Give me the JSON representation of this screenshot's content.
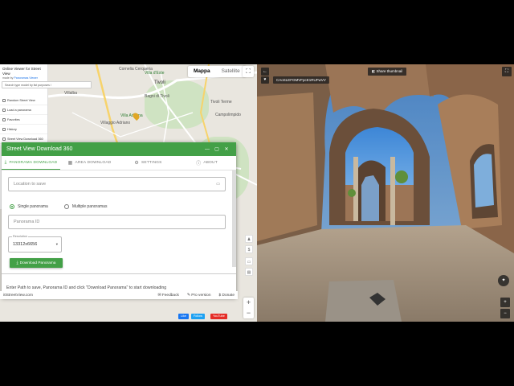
{
  "map": {
    "panel_title": "Online Viewer for Street View",
    "panel_subtitle_prefix": "made by",
    "panel_subtitle_link": "Panoramas Viewer",
    "search_placeholder": "Search type model by list purposes /",
    "panel_items": [
      "Random Street View",
      "Load a panorama",
      "Favorites",
      "History",
      "Street View Download 360"
    ],
    "type_tabs": [
      "Mappa",
      "Satellite"
    ],
    "places": [
      "Tivoli",
      "Villa d'Este",
      "Villa Adriana",
      "Villaggio Adriano",
      "Villalba",
      "Cornelia Cerqueria",
      "Bagni di Tivoli",
      "Tivoli Terme",
      "Campolimpido"
    ],
    "footer_site": "i0StreetView.com",
    "footer_links": [
      "Feedback",
      "Pro version",
      "Donate"
    ],
    "social": [
      "Like",
      "Follow",
      "YouTube"
    ],
    "zoom_in": "+",
    "zoom_out": "−"
  },
  "dialog": {
    "title": "Street View Download 360",
    "tabs": [
      {
        "label": "PANORAMA DOWNLOAD",
        "icon": "download-icon"
      },
      {
        "label": "AREA DOWNLOAD",
        "icon": "map-icon"
      },
      {
        "label": "SETTINGS",
        "icon": "gear-icon"
      },
      {
        "label": "ABOUT",
        "icon": "info-icon"
      }
    ],
    "location_placeholder": "Location to save",
    "radio_single": "Single panorama",
    "radio_multiple": "Multiple panoramas",
    "radio_selected": "single",
    "panorama_id_placeholder": "Panorama ID",
    "resolution_label": "Resolution",
    "resolution_value": "13312x6656",
    "download_button": "Download Panorama",
    "hint": "Enter Path to save, Panorama ID and click \"Download Panorama\" to start downloading"
  },
  "pano": {
    "id_text": "CAoSLEFGMVFpcE1RUFwVV",
    "share_button": "Share thumbnail"
  },
  "colors": {
    "accent": "#43a047",
    "map_bg": "#e9e6df"
  }
}
